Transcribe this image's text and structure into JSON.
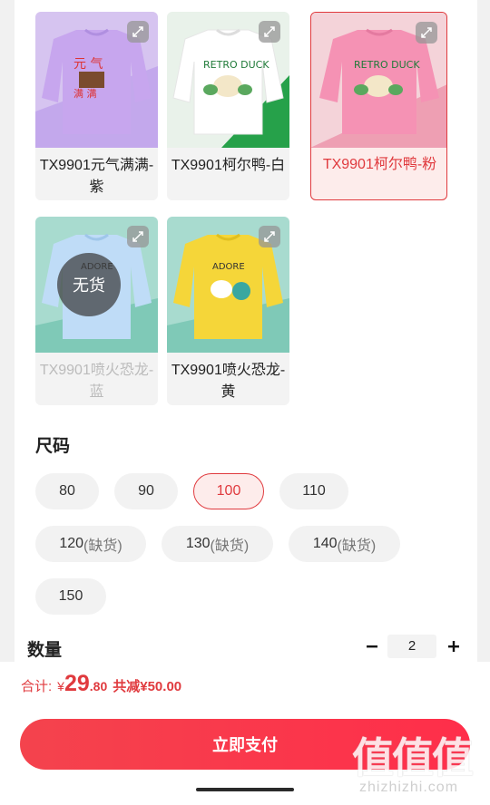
{
  "variants": [
    {
      "label": "TX9901元气满满-紫",
      "state": "normal",
      "bg_color": "#c9b3ec",
      "shirt_color": "#c7a6ee",
      "bottom_color": "#b997e3"
    },
    {
      "label": "TX9901柯尔鸭-白",
      "state": "normal",
      "bg_color": "#e9f2ea",
      "shirt_color": "#ffffff",
      "bottom_color": "#26a14a"
    },
    {
      "label": "TX9901柯尔鸭-粉",
      "state": "selected",
      "bg_color": "#f4d3d9",
      "shirt_color": "#f592b4",
      "bottom_color": "#ee9fb3"
    },
    {
      "label": "TX9901喷火恐龙-蓝",
      "state": "disabled",
      "sold_out_label": "无货",
      "bg_color": "#a8dbcf",
      "shirt_color": "#bfdcf7",
      "bottom_color": "#7fc9b7"
    },
    {
      "label": "TX9901喷火恐龙-黄",
      "state": "normal",
      "bg_color": "#a8dbcf",
      "shirt_color": "#f5d639",
      "bottom_color": "#7fc9b7"
    }
  ],
  "size_section": {
    "title": "尺码",
    "options": [
      {
        "value": "80",
        "note": "",
        "state": "normal"
      },
      {
        "value": "90",
        "note": "",
        "state": "normal"
      },
      {
        "value": "100",
        "note": "",
        "state": "selected"
      },
      {
        "value": "110",
        "note": "",
        "state": "normal"
      },
      {
        "value": "120",
        "note": "(缺货)",
        "state": "out_of_stock"
      },
      {
        "value": "130",
        "note": "(缺货)",
        "state": "out_of_stock"
      },
      {
        "value": "140",
        "note": "(缺货)",
        "state": "out_of_stock"
      },
      {
        "value": "150",
        "note": "",
        "state": "normal"
      }
    ]
  },
  "quantity": {
    "title": "数量",
    "value": "2",
    "minus_icon": "minus-icon",
    "plus_icon": "plus-icon"
  },
  "summary": {
    "total_label": "合计:",
    "currency": "¥",
    "total_int": "29",
    "total_dec": ".80",
    "savings": "共减¥50.00"
  },
  "pay_button": "立即支付",
  "watermark": {
    "big": "值值值",
    "small": "zhizhizhi.com"
  },
  "colors": {
    "accent": "#e03a3e",
    "chip_bg": "#f2f2f2",
    "pay_gradient_start": "#f4434d",
    "pay_gradient_end": "#ff2e4a"
  }
}
